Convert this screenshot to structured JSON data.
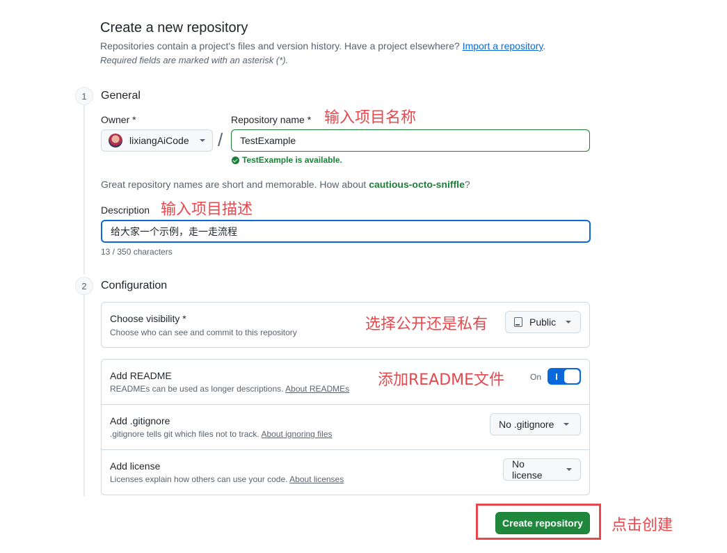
{
  "header": {
    "title": "Create a new repository",
    "intro_text": "Repositories contain a project's files and version history. Have a project elsewhere? ",
    "import_link": "Import a repository",
    "intro_end": ".",
    "required_note": "Required fields are marked with an asterisk (*)."
  },
  "general": {
    "step": "1",
    "title": "General",
    "owner_label": "Owner *",
    "owner_value": "lixiangAiCode",
    "repo_name_label": "Repository name *",
    "repo_name_value": "TestExample",
    "availability": "TestExample is available.",
    "suggestion_text": "Great repository names are short and memorable. How about ",
    "suggestion_name": "cautious-octo-sniffle",
    "suggestion_end": "?",
    "description_label": "Description",
    "description_value": "给大家一个示例，走一走流程",
    "char_count": "13 / 350 characters"
  },
  "configuration": {
    "step": "2",
    "title": "Configuration",
    "visibility_title": "Choose visibility *",
    "visibility_sub": "Choose who can see and commit to this repository",
    "visibility_value": "Public",
    "readme_title": "Add README",
    "readme_sub": "READMEs can be used as longer descriptions. ",
    "readme_link": "About READMEs",
    "readme_toggle_label": "On",
    "readme_enabled": true,
    "gitignore_title": "Add .gitignore",
    "gitignore_sub": ".gitignore tells git which files not to track. ",
    "gitignore_link": "About ignoring files",
    "gitignore_value": "No .gitignore",
    "license_title": "Add license",
    "license_sub": "Licenses explain how others can use your code. ",
    "license_link": "About licenses",
    "license_value": "No license"
  },
  "actions": {
    "create_label": "Create repository"
  },
  "annotations": {
    "repo_name": "输入项目名称",
    "description": "输入项目描述",
    "visibility": "选择公开还是私有",
    "readme": "添加README文件",
    "create": "点击创建"
  },
  "colors": {
    "accent_blue": "#0969da",
    "success_green": "#1a7f37",
    "create_button": "#1f883d",
    "annotation_red": "#e5484d"
  }
}
